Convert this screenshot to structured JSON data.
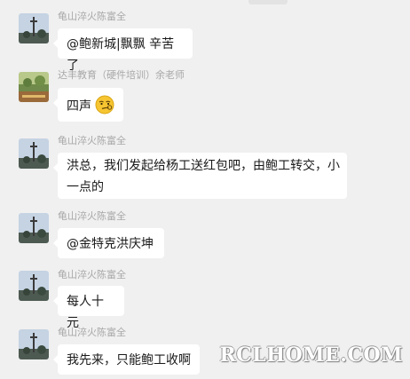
{
  "messages": [
    {
      "sender": "龟山淬火陈富全",
      "text": "@鲍新城|飘飘 辛苦了",
      "avatar": "tower-avatar"
    },
    {
      "sender": "达丰教育（硬件培训）余老师",
      "text": "四声",
      "emoji": "smirk-emoji",
      "avatar": "landscape-avatar"
    },
    {
      "sender": "龟山淬火陈富全",
      "text_line1": "洪总，我们发起给杨工送红包吧，由鲍工转交，小",
      "text_line2": "一点的",
      "avatar": "tower-avatar"
    },
    {
      "sender": "龟山淬火陈富全",
      "text": "@金特克洪庆坤",
      "avatar": "tower-avatar"
    },
    {
      "sender": "龟山淬火陈富全",
      "text": "每人十元",
      "avatar": "tower-avatar"
    },
    {
      "sender": "龟山淬火陈富全",
      "text": "我先来，只能鲍工收啊",
      "avatar": "tower-avatar"
    }
  ],
  "watermark": "RCLHOME.COM"
}
